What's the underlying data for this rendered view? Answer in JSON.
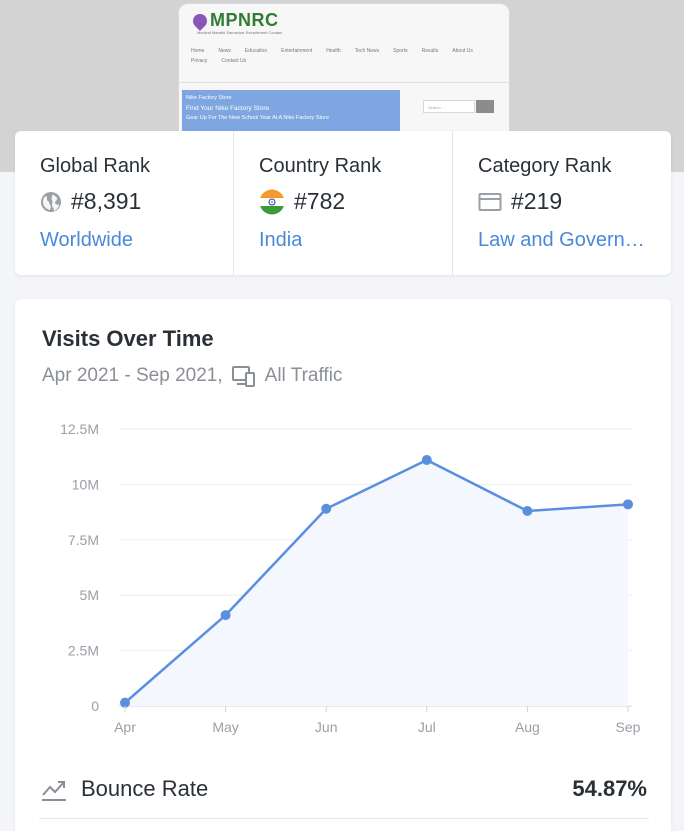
{
  "preview": {
    "logo_text": "MPNRC",
    "tagline": "Medical Marathi Samachar Recruitment Contact",
    "nav": [
      "Home",
      "News",
      "Education",
      "Entertainment",
      "Health",
      "Tech News",
      "Sports",
      "Results",
      "About Us",
      "Privacy",
      "Contact Us"
    ],
    "banner_line1": "Nike Factory Store",
    "banner_line2": "Find Your Nike Factory Store",
    "banner_line3": "Gear Up For The New School Year At A Nike Factory Store",
    "search_placeholder": "Search ..."
  },
  "ranks": [
    {
      "title": "Global Rank",
      "icon": "globe-icon",
      "value": "#8,391",
      "link": "Worldwide"
    },
    {
      "title": "Country Rank",
      "icon": "india-flag-icon",
      "value": "#782",
      "link": "India"
    },
    {
      "title": "Category Rank",
      "icon": "category-icon",
      "value": "#219",
      "link": "Law and Government"
    }
  ],
  "visits": {
    "title": "Visits Over Time",
    "date_range": "Apr 2021 - Sep 2021,",
    "traffic": "All Traffic"
  },
  "chart_data": {
    "type": "area",
    "x": [
      "Apr",
      "May",
      "Jun",
      "Jul",
      "Aug",
      "Sep"
    ],
    "values": [
      0.15,
      4.1,
      8.9,
      11.1,
      8.8,
      9.1
    ],
    "yticks": [
      "0",
      "2.5M",
      "5M",
      "7.5M",
      "10M",
      "12.5M"
    ],
    "ylim": [
      0,
      12.5
    ],
    "grid": true,
    "line_color": "#5a8fe0",
    "fill_color": "#f4f7fd"
  },
  "bounce": {
    "label": "Bounce Rate",
    "value": "54.87%"
  },
  "colors": {
    "accent": "#4a88d9",
    "text": "#2a3037",
    "muted": "#8a8f96"
  }
}
